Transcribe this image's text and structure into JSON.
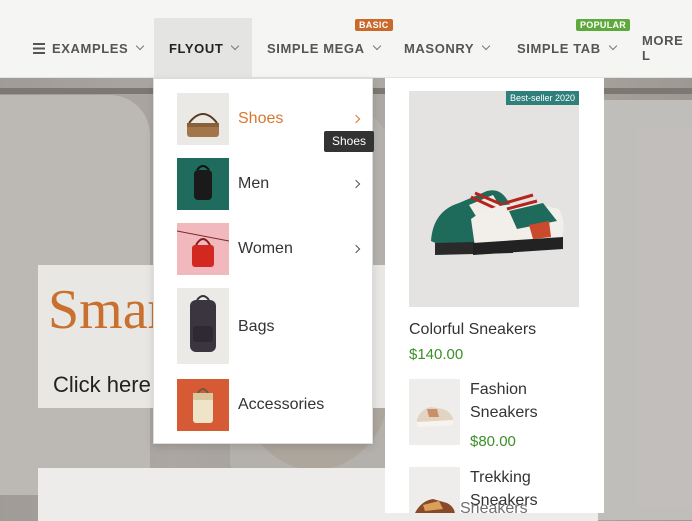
{
  "nav": {
    "items": [
      {
        "label": "EXAMPLES",
        "icon": "hamburger-menu-icon"
      },
      {
        "label": "FLYOUT",
        "active": true
      },
      {
        "label": "SIMPLE MEGA",
        "badge": "BASIC"
      },
      {
        "label": "MASONRY"
      },
      {
        "label": "SIMPLE TAB",
        "badge": "POPULAR"
      },
      {
        "label": "MORE L"
      }
    ]
  },
  "hero": {
    "title": "Smar",
    "link": "Click here"
  },
  "flyout": {
    "items": [
      {
        "label": "Shoes",
        "has_submenu": true,
        "active": true
      },
      {
        "label": "Men",
        "has_submenu": true
      },
      {
        "label": "Women",
        "has_submenu": true
      },
      {
        "label": "Bags",
        "has_submenu": false
      },
      {
        "label": "Accessories",
        "has_submenu": false
      }
    ],
    "tooltip": "Shoes"
  },
  "products": {
    "featured": {
      "badge": "Best-seller 2020",
      "name": "Colorful Sneakers",
      "price": "$140.00"
    },
    "list": [
      {
        "name": "Fashion Sneakers",
        "price": "$80.00"
      },
      {
        "name": "Trekking Sneakers"
      }
    ],
    "behind_text": "Sneakers"
  },
  "colors": {
    "accent": "#d9772f",
    "price": "#3c8f2a",
    "badge_basic": "#c9692c",
    "badge_popular": "#5ea93c",
    "bestseller": "#2f7f7b"
  }
}
